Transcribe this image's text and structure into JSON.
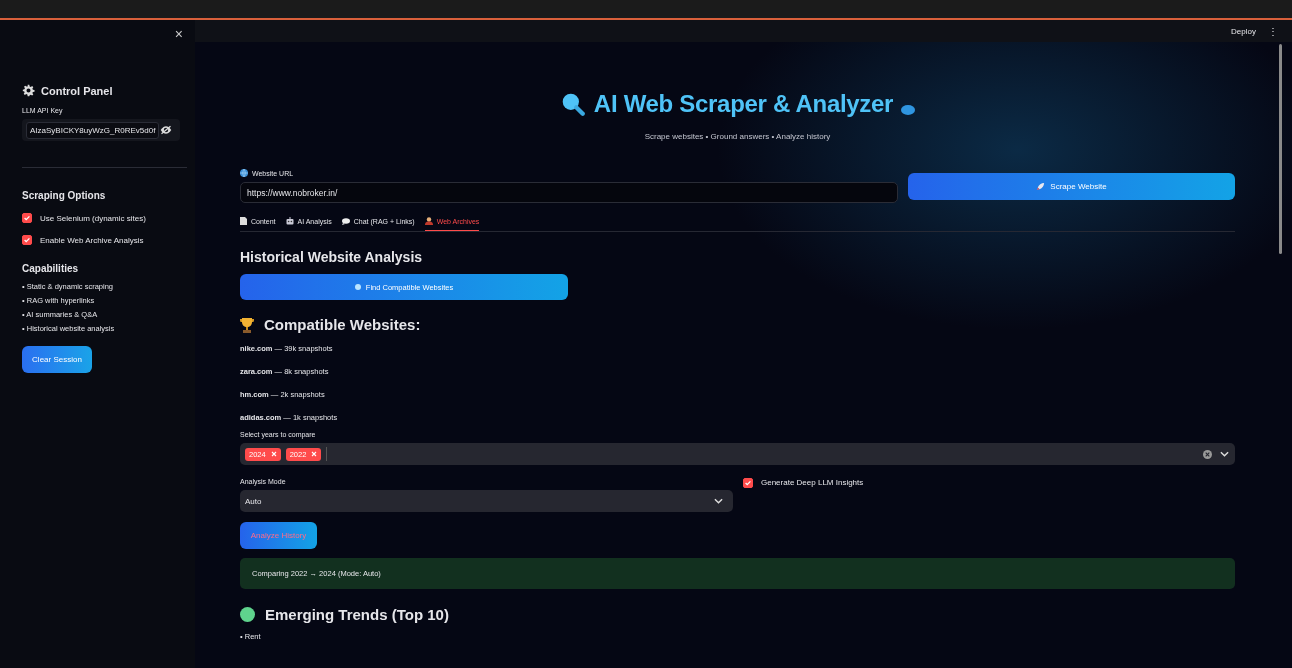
{
  "sidebar": {
    "close": "×",
    "title": "Control Panel",
    "api_key": {
      "label": "LLM API Key",
      "value": "AIzaSyBICKY8uyWzG_R0REv5d0f"
    },
    "scraping_heading": "Scraping Options",
    "options": [
      {
        "label": "Use Selenium (dynamic sites)",
        "checked": true
      },
      {
        "label": "Enable Web Archive Analysis",
        "checked": true
      }
    ],
    "capabilities_heading": "Capabilities",
    "capabilities": [
      "• Static & dynamic scraping",
      "• RAG with hyperlinks",
      "• AI summaries & Q&A",
      "• Historical website analysis"
    ],
    "clear_button": "Clear Session"
  },
  "header": {
    "deploy": "Deploy",
    "menu": "⋮"
  },
  "hero": {
    "title": "AI Web Scraper & Analyzer",
    "subtitle": "Scrape websites • Ground answers • Analyze history"
  },
  "url": {
    "label": "Website URL",
    "value": "https://www.nobroker.in/"
  },
  "scrape_button": "Scrape Website",
  "tabs": [
    {
      "label": "Content",
      "kind": "document",
      "selected": false
    },
    {
      "label": "AI Analysis",
      "kind": "robot",
      "selected": false
    },
    {
      "label": "Chat (RAG + Links)",
      "kind": "chat",
      "selected": false
    },
    {
      "label": "Web Archives",
      "kind": "archive",
      "selected": true
    }
  ],
  "section_title": "Historical Website Analysis",
  "find_button": "Find Compatible Websites",
  "compatible_heading": "Compatible Websites:",
  "websites": [
    {
      "domain": "nike.com",
      "snapshots": "— 39k snapshots"
    },
    {
      "domain": "zara.com",
      "snapshots": "— 8k snapshots"
    },
    {
      "domain": "hm.com",
      "snapshots": "— 2k snapshots"
    },
    {
      "domain": "adidas.com",
      "snapshots": "— 1k snapshots"
    }
  ],
  "years": {
    "label": "Select years to compare",
    "tags": [
      "2024",
      "2022"
    ]
  },
  "analysis_mode": {
    "label": "Analysis Mode",
    "value": "Auto"
  },
  "deep_insights": {
    "label": "Generate Deep LLM Insights",
    "checked": true
  },
  "analyze_button": "Analyze History",
  "status": "Comparing 2022 → 2024 (Mode: Auto)",
  "trends_heading": "Emerging Trends (Top 10)",
  "trends": [
    "• Rent"
  ]
}
